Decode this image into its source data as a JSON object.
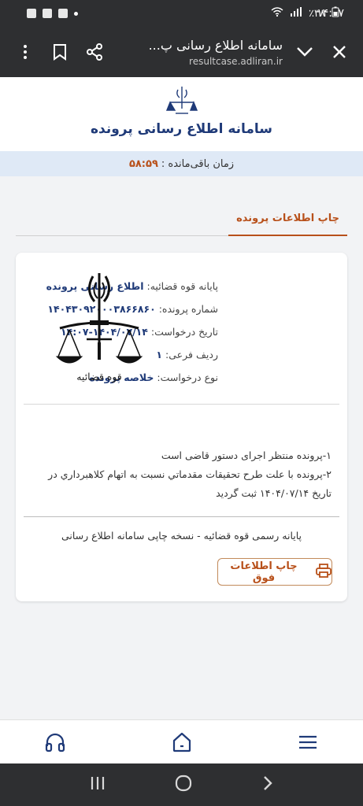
{
  "status_bar": {
    "battery": "٪۳۸",
    "time": "۱۴:۰۷"
  },
  "browser": {
    "title": "سامانه اطلاع رسانی پ...",
    "url": "resultcase.adliran.ir"
  },
  "site": {
    "title": "سامانه اطلاع رسانی پرونده",
    "timer_label": "زمان باقی‌مانده :",
    "timer_value": "۵۸:۵۹"
  },
  "tab": {
    "label": "چاپ اطلاعات پرونده"
  },
  "card": {
    "rows": [
      {
        "label": "پایانه قوه قضائیه:",
        "value": "اطلاع رسانی پرونده"
      },
      {
        "label": "شماره پرونده:",
        "value": "۱۴۰۴۳۰۹۲۰۰۰۳۸۶۶۸۶۰"
      },
      {
        "label": "تاریخ درخواست:",
        "value": "۱۴۰۴/۰۷/۱۴-۱۴:۰۷"
      },
      {
        "label": "ردیف فرعی:",
        "value": "۱"
      },
      {
        "label": "نوع درخواست:",
        "value": "خلاصه پرونده"
      }
    ],
    "logo_caption": "قوه قضائیه",
    "desc_line1": "۱-پرونده منتظر اجرای دستور قاضی است",
    "desc_line2": "۲-پرونده با علت طرح تحقیقات مقدماتي نسبت به اتهام كلاهبرداري در تاریخ ۱۴۰۴/۰۷/۱۴ ثبت گردید",
    "footer_note": "پایانه رسمی قوه قضائیه - نسخه چاپی سامانه اطلاع رسانی",
    "print_label": "چاپ اطلاعات فوق"
  },
  "colors": {
    "accent": "#b8501a",
    "brand": "#1f3a78",
    "chrome": "#2e2f31"
  }
}
